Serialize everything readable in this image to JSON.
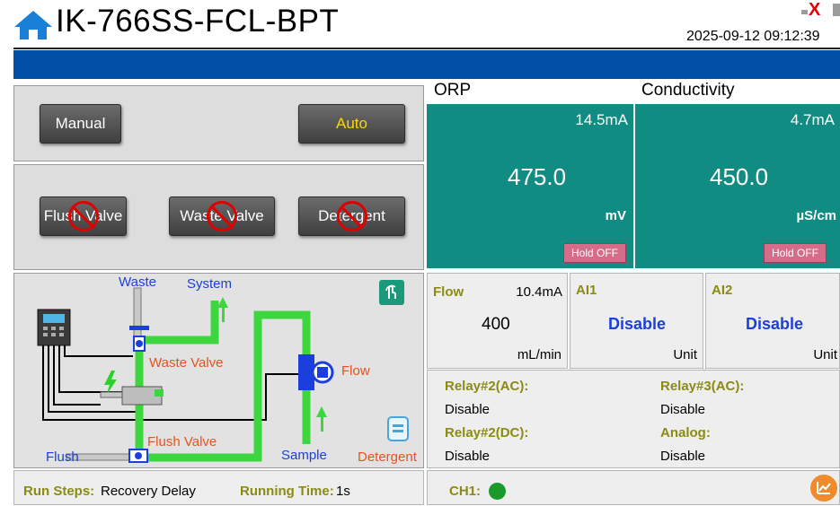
{
  "header": {
    "title": "IK-766SS-FCL-BPT",
    "datetime": "2025-09-12 09:12:39",
    "close_glyph": "X"
  },
  "mode_buttons": {
    "manual": "Manual",
    "auto": "Auto",
    "auto_color": "#ffd700"
  },
  "valve_buttons": [
    {
      "label": "Flush Valve",
      "state_icon": "prohibited-icon"
    },
    {
      "label": "Waste Valve",
      "state_icon": "prohibited-icon"
    },
    {
      "label": "Detergent",
      "state_icon": "prohibited-icon"
    }
  ],
  "diagram": {
    "waste": "Waste",
    "system": "System",
    "waste_valve": "Waste Valve",
    "flow": "Flow",
    "flush_valve": "Flush Valve",
    "flush": "Flush",
    "sample": "Sample",
    "detergent": "Detergent",
    "label_blue": "#1a3fdc",
    "label_orange": "#e8521e",
    "pipe_green": "#3ed63e"
  },
  "sensors": [
    {
      "title": "ORP",
      "current": "14.5mA",
      "value": "475.0",
      "unit": "mV",
      "hold": "Hold OFF"
    },
    {
      "title": "Conductivity",
      "current": "4.7mA",
      "value": "450.0",
      "unit": "µS/cm",
      "hold": "Hold OFF"
    }
  ],
  "flow_cell": {
    "title": "Flow",
    "current": "10.4mA",
    "value": "400",
    "unit": "mL/min"
  },
  "ai1": {
    "title": "AI1",
    "value": "Disable",
    "unit": "Unit"
  },
  "ai2": {
    "title": "AI2",
    "value": "Disable",
    "unit": "Unit"
  },
  "relays": [
    {
      "title": "Relay#2(AC):",
      "value": "Disable"
    },
    {
      "title": "Relay#3(AC):",
      "value": "Disable"
    },
    {
      "title": "Relay#2(DC):",
      "value": "Disable"
    },
    {
      "title": "Analog:",
      "value": "Disable"
    }
  ],
  "status": {
    "run_steps_label": "Run Steps:",
    "run_steps_value": "Recovery Delay",
    "running_time_label": "Running Time:",
    "running_time_value": "1s",
    "ch1_label": "CH1:",
    "ch1_color": "#1a9a2a"
  },
  "colors": {
    "teal": "#118c82",
    "header_blue": "#0050a8",
    "olive": "#8b8b14"
  }
}
